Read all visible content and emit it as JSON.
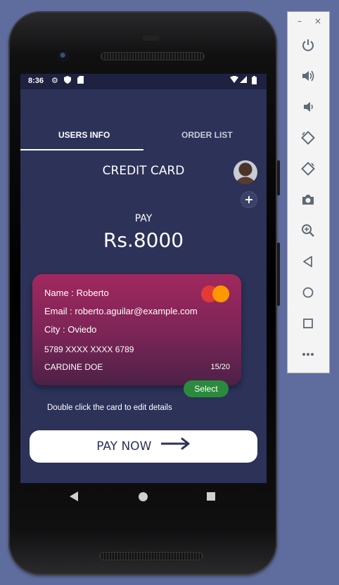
{
  "status_bar": {
    "time": "8:36"
  },
  "tabs": [
    {
      "label": "USERS INFO",
      "active": true
    },
    {
      "label": "ORDER LIST",
      "active": false
    }
  ],
  "header": {
    "title": "CREDIT CARD"
  },
  "payment": {
    "label": "PAY",
    "amount": "Rs.8000"
  },
  "card": {
    "name": "Name : Roberto",
    "email": "Email : roberto.aguilar@example.com",
    "city": "City : Oviedo",
    "number": "5789 XXXX XXXX 6789",
    "holder": "CARDINE DOE",
    "expiry": "15/20"
  },
  "select_label": "Select",
  "hint": "Double click the card to edit details",
  "pay_now_label": "PAY NOW",
  "colors": {
    "screen_bg": "#2c3258",
    "card_gradient_top": "#a1285e",
    "card_gradient_bottom": "#4c2147",
    "select_green": "#2b8a3e",
    "desktop_bg": "#5f6c9e"
  },
  "toolbar": {
    "icons": [
      "power-icon",
      "volume-up-icon",
      "volume-down-icon",
      "rotate-left-icon",
      "rotate-right-icon",
      "camera-icon",
      "zoom-in-icon",
      "back-icon",
      "home-icon",
      "overview-icon",
      "more-icon"
    ]
  }
}
